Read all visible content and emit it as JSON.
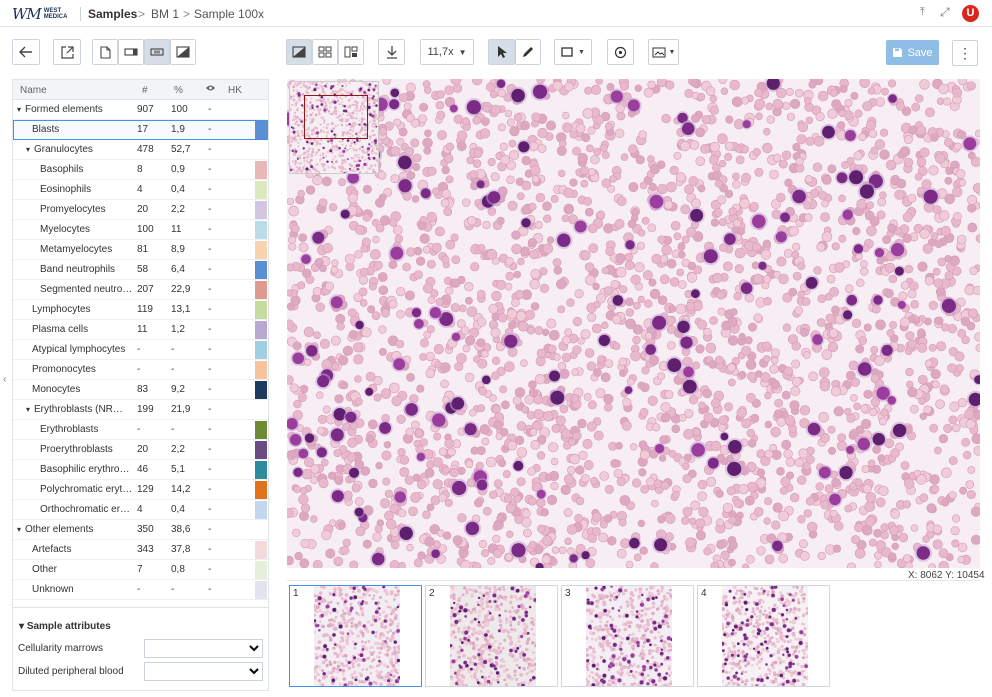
{
  "brand": {
    "logo_mark": "WM",
    "logo_text_1": "WEST",
    "logo_text_2": "MEDICA"
  },
  "breadcrumb": {
    "item1": "Samples",
    "sep": ">",
    "item2": "BM 1",
    "item3": "Sample 100x"
  },
  "topbar": {
    "user_initial": "U",
    "pin_icon": "pin-icon",
    "expand_icon": "expand-icon"
  },
  "toolbar": {
    "zoom": "11,7x",
    "save_label": "Save"
  },
  "colors": {
    "accent": "#4a90e2",
    "save": "#8fbde6",
    "user": "#d7281d",
    "stain_purple": "#7b2a86",
    "stain_pink": "#e7b3c9"
  },
  "table": {
    "headers": {
      "name": "Name",
      "count": "#",
      "percent": "%",
      "visible": "eye-icon",
      "hk": "HK"
    },
    "rows": [
      {
        "level": 0,
        "caret": "▾",
        "name": "Formed elements",
        "count": "907",
        "pct": "100",
        "dash": "-",
        "color": ""
      },
      {
        "level": 1,
        "caret": "",
        "name": "Blasts",
        "count": "17",
        "pct": "1,9",
        "dash": "-",
        "color": "#5b8fd4",
        "selected": true
      },
      {
        "level": 1,
        "caret": "▾",
        "name": "Granulocytes",
        "count": "478",
        "pct": "52,7",
        "dash": "-",
        "color": ""
      },
      {
        "level": 2,
        "caret": "",
        "name": "Basophils",
        "count": "8",
        "pct": "0,9",
        "dash": "-",
        "color": "#e8b8b8"
      },
      {
        "level": 2,
        "caret": "",
        "name": "Eosinophils",
        "count": "4",
        "pct": "0,4",
        "dash": "-",
        "color": "#dce8c0"
      },
      {
        "level": 2,
        "caret": "",
        "name": "Promyelocytes",
        "count": "20",
        "pct": "2,2",
        "dash": "-",
        "color": "#d3c6e3"
      },
      {
        "level": 2,
        "caret": "",
        "name": "Myelocytes",
        "count": "100",
        "pct": "11",
        "dash": "-",
        "color": "#bcdcea"
      },
      {
        "level": 2,
        "caret": "",
        "name": "Metamyelocytes",
        "count": "81",
        "pct": "8,9",
        "dash": "-",
        "color": "#f7d3b0"
      },
      {
        "level": 2,
        "caret": "",
        "name": "Band neutrophils",
        "count": "58",
        "pct": "6,4",
        "dash": "-",
        "color": "#5b8fd4"
      },
      {
        "level": 2,
        "caret": "",
        "name": "Segmented neutrop...",
        "count": "207",
        "pct": "22,9",
        "dash": "-",
        "color": "#dc9a90"
      },
      {
        "level": 1,
        "caret": "",
        "name": "Lymphocytes",
        "count": "119",
        "pct": "13,1",
        "dash": "-",
        "color": "#c5dc9e"
      },
      {
        "level": 1,
        "caret": "",
        "name": "Plasma cells",
        "count": "11",
        "pct": "1,2",
        "dash": "-",
        "color": "#b7a8cf"
      },
      {
        "level": 1,
        "caret": "",
        "name": "Atypical lymphocytes",
        "count": "-",
        "pct": "-",
        "dash": "-",
        "color": "#9fcfe0"
      },
      {
        "level": 1,
        "caret": "",
        "name": "Promonocytes",
        "count": "-",
        "pct": "-",
        "dash": "-",
        "color": "#f6c39a"
      },
      {
        "level": 1,
        "caret": "",
        "name": "Monocytes",
        "count": "83",
        "pct": "9,2",
        "dash": "-",
        "color": "#1d3a5f"
      },
      {
        "level": 1,
        "caret": "▾",
        "name": "Erythroblasts (NRBC)",
        "count": "199",
        "pct": "21,9",
        "dash": "-",
        "color": ""
      },
      {
        "level": 2,
        "caret": "",
        "name": "Erythroblasts",
        "count": "-",
        "pct": "-",
        "dash": "-",
        "color": "#6e8a35"
      },
      {
        "level": 2,
        "caret": "",
        "name": "Proerythroblasts",
        "count": "20",
        "pct": "2,2",
        "dash": "-",
        "color": "#6a4b82"
      },
      {
        "level": 2,
        "caret": "",
        "name": "Basophilic erythrobl...",
        "count": "46",
        "pct": "5,1",
        "dash": "-",
        "color": "#2f8a9e"
      },
      {
        "level": 2,
        "caret": "",
        "name": "Polychromatic erythr...",
        "count": "129",
        "pct": "14,2",
        "dash": "-",
        "color": "#e0731a"
      },
      {
        "level": 2,
        "caret": "",
        "name": "Orthochromatic eryt...",
        "count": "4",
        "pct": "0,4",
        "dash": "-",
        "color": "#c2d6ef"
      },
      {
        "level": 0,
        "caret": "▾",
        "name": "Other elements",
        "count": "350",
        "pct": "38,6",
        "dash": "-",
        "color": ""
      },
      {
        "level": 1,
        "caret": "",
        "name": "Artefacts",
        "count": "343",
        "pct": "37,8",
        "dash": "-",
        "color": "#f4dada"
      },
      {
        "level": 1,
        "caret": "",
        "name": "Other",
        "count": "7",
        "pct": "0,8",
        "dash": "-",
        "color": "#e6efda"
      },
      {
        "level": 1,
        "caret": "",
        "name": "Unknown",
        "count": "-",
        "pct": "-",
        "dash": "-",
        "color": "#e3e3ee"
      }
    ]
  },
  "attributes": {
    "title": "Sample attributes",
    "caret": "▾",
    "fields": [
      {
        "label": "Cellularity marrows",
        "value": ""
      },
      {
        "label": "Diluted peripheral blood",
        "value": ""
      }
    ]
  },
  "viewer": {
    "coords": "X: 8062  Y: 10454"
  },
  "thumbnails": [
    {
      "n": "1"
    },
    {
      "n": "2"
    },
    {
      "n": "3"
    },
    {
      "n": "4"
    }
  ]
}
